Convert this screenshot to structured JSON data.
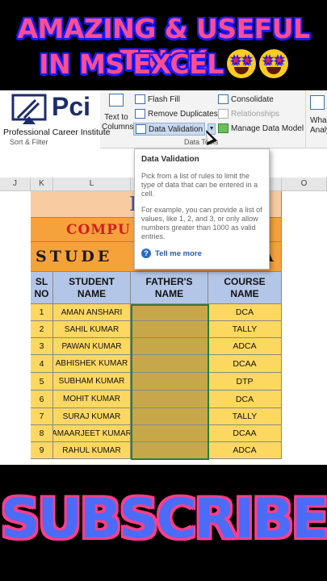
{
  "banner": {
    "line1": "AMAZING & USEFUL TRICK",
    "line2": "IN MS EXCEL",
    "bottom": "SUBSCRIBE"
  },
  "logo": {
    "text": "Pci",
    "subtitle": "Professional Career Institute"
  },
  "ribbon": {
    "sort_filter_label": "Sort & Filter",
    "data_tools_label": "Data Tools",
    "text_to_columns": [
      "Text to",
      "Columns"
    ],
    "flash_fill": "Flash Fill",
    "remove_duplicates": "Remove Duplicates",
    "data_validation": "Data Validation",
    "consolidate": "Consolidate",
    "relationships": "Relationships",
    "manage_data_model": "Manage Data Model",
    "what_if": [
      "What",
      "Analy"
    ]
  },
  "tooltip": {
    "title": "Data Validation",
    "body1": "Pick from a list of rules to limit the type of data that can be entered in a cell.",
    "body2": "For example, you can provide a list of values, like 1, 2, and 3, or only allow numbers greater than 1000 as valid entries.",
    "link": "Tell me more"
  },
  "columns": [
    "J",
    "K",
    "L",
    "M",
    "N",
    "O"
  ],
  "sheet": {
    "title_fragment": "I",
    "compu": "COMPU",
    "student_fragment": "STUDE",
    "a_fragment": "A",
    "headers": {
      "sl": [
        "SL",
        "NO"
      ],
      "student": [
        "STUDENT",
        "NAME"
      ],
      "father": [
        "FATHER'S",
        "NAME"
      ],
      "course": [
        "COURSE",
        "NAME"
      ]
    },
    "rows": [
      {
        "no": "1",
        "name": "AMAN ANSHARI",
        "course": "DCA"
      },
      {
        "no": "2",
        "name": "SAHIL KUMAR",
        "course": "TALLY"
      },
      {
        "no": "3",
        "name": "PAWAN KUMAR",
        "course": "ADCA"
      },
      {
        "no": "4",
        "name": "ABHISHEK KUMAR",
        "course": "DCAA"
      },
      {
        "no": "5",
        "name": "SUBHAM KUMAR",
        "course": "DTP"
      },
      {
        "no": "6",
        "name": "MOHIT KUMAR",
        "course": "DCA"
      },
      {
        "no": "7",
        "name": "SURAJ KUMAR",
        "course": "TALLY"
      },
      {
        "no": "8",
        "name": "AMAARJEET KUMAR",
        "course": "DCAA"
      },
      {
        "no": "9",
        "name": "RAHUL KUMAR",
        "course": "ADCA"
      }
    ]
  },
  "colors": {
    "banner_text": "#ff4d8f",
    "peach_title": "#f8cba0",
    "orange_band": "#f6a23c",
    "header_blue": "#b4c6e7",
    "row_yellow": "#fdd861",
    "selection_fill": "#c6a84a",
    "subscribe_fill": "#4a6cf7"
  }
}
